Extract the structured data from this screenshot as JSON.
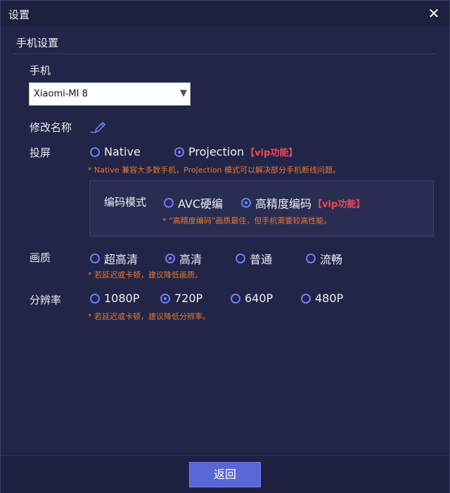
{
  "window": {
    "title": "设置",
    "close_icon": "close-icon"
  },
  "section": {
    "title": "手机设置"
  },
  "phone": {
    "label": "手机",
    "selected": "Xiaomi-MI 8",
    "arrow": "▼"
  },
  "rename": {
    "label": "修改名称",
    "icon": "pencil-icon"
  },
  "projection": {
    "label": "投屏",
    "options": [
      {
        "label": "Native",
        "selected": false,
        "vip": ""
      },
      {
        "label": "Projection",
        "selected": true,
        "vip": "【vip功能】"
      }
    ],
    "note": "* Native 兼容大多数手机，Projection 模式可以解决部分手机断线问题。"
  },
  "encoding": {
    "label": "编码模式",
    "options": [
      {
        "label": "AVC硬编",
        "selected": false,
        "vip": ""
      },
      {
        "label": "高精度编码",
        "selected": true,
        "vip": "【vip功能】"
      }
    ],
    "note": "* “高精度编码”画质最佳，但手机需要较高性能。"
  },
  "quality": {
    "label": "画质",
    "options": [
      {
        "label": "超高清",
        "selected": false
      },
      {
        "label": "高清",
        "selected": true
      },
      {
        "label": "普通",
        "selected": false
      },
      {
        "label": "流畅",
        "selected": false
      }
    ],
    "note": "* 若延迟或卡顿，建议降低画质。"
  },
  "resolution": {
    "label": "分辨率",
    "options": [
      {
        "label": "1080P",
        "selected": false
      },
      {
        "label": "720P",
        "selected": true
      },
      {
        "label": "640P",
        "selected": false
      },
      {
        "label": "480P",
        "selected": false
      }
    ],
    "note": "* 若延迟或卡顿，建议降低分辨率。"
  },
  "footer": {
    "back_label": "返回"
  },
  "colors": {
    "accent": "#5966d6",
    "note": "#e8772e",
    "vip": "#e84a5a",
    "background": "#222547"
  }
}
